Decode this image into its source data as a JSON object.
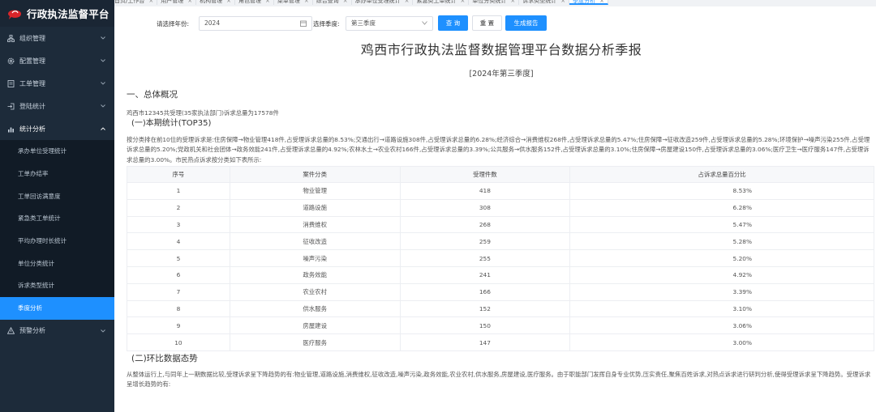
{
  "app": {
    "title": "行政执法监督平台"
  },
  "sidebar": {
    "groups": [
      {
        "label": "组织管理",
        "icon": "org-icon"
      },
      {
        "label": "配置管理",
        "icon": "gear-icon"
      },
      {
        "label": "工单管理",
        "icon": "ticket-icon"
      },
      {
        "label": "登陆统计",
        "icon": "login-icon"
      },
      {
        "label": "统计分析",
        "icon": "chart-icon"
      }
    ],
    "subitems": [
      "承办单位受理统计",
      "工单办结率",
      "工单回访满意度",
      "紧急类工单统计",
      "平均办理时长统计",
      "单位分类统计",
      "诉求类型统计",
      "季度分析"
    ],
    "footer_group": {
      "label": "预警分析",
      "icon": "warning-icon"
    }
  },
  "tabs": [
    "首页/工作台",
    "用户管理",
    "机构管理",
    "角色管理",
    "菜单管理",
    "综合查询",
    "承办单位受理统计",
    "紧急类工单统计",
    "单位分类统计",
    "诉求类型统计",
    "季度分析"
  ],
  "filter": {
    "year_label": "请选择年份:",
    "year_value": "2024",
    "season_label": "选择季度:",
    "season_value": "第三季度",
    "query_button": "查 询",
    "reset_button": "重 置",
    "report_button": "生成报告"
  },
  "report": {
    "title": "鸡西市行政执法监督数据管理平台数据分析季报",
    "period": "[2024年第三季度]",
    "section1_title": "一、总体概况",
    "summary": "鸡西市12345共受理(35家执法部门)诉求总量为17578件",
    "sub1_title": "(一)本期统计(TOP35)",
    "sub1_text": "按分类排在前10位的受理诉求是:住房保障→物业管理418件,占受理诉求总量的8.53%;交通出行→道路设施308件,占受理诉求总量的6.28%;经济综合→消费维权268件,占受理诉求总量的5.47%;住房保障→征收改造259件,占受理诉求总量的5.28%;环境保护→噪声污染255件,占受理诉求总量的5.20%;党政机关和社会团体→政务效能241件,占受理诉求总量的4.92%;农林水土→农业农村166件,占受理诉求总量的3.39%;公共服务→供水服务152件,占受理诉求总量的3.10%;住房保障→房屋建设150件,占受理诉求总量的3.06%;医疗卫生→医疗服务147件,占受理诉求总量的3.00%。市民热点诉求按分类如下表所示:",
    "table": {
      "headers": [
        "序号",
        "案件分类",
        "受理件数",
        "占诉求总量百分比"
      ],
      "rows": [
        [
          "1",
          "物业管理",
          "418",
          "8.53%"
        ],
        [
          "2",
          "道路设施",
          "308",
          "6.28%"
        ],
        [
          "3",
          "消费维权",
          "268",
          "5.47%"
        ],
        [
          "4",
          "征收改造",
          "259",
          "5.28%"
        ],
        [
          "5",
          "噪声污染",
          "255",
          "5.20%"
        ],
        [
          "6",
          "政务效能",
          "241",
          "4.92%"
        ],
        [
          "7",
          "农业农村",
          "166",
          "3.39%"
        ],
        [
          "8",
          "供水服务",
          "152",
          "3.10%"
        ],
        [
          "9",
          "房屋建设",
          "150",
          "3.06%"
        ],
        [
          "10",
          "医疗服务",
          "147",
          "3.00%"
        ]
      ]
    },
    "sub2_title": "(二)环比数据态势",
    "sub2_text": "从整体运行上,与同年上一期数据比较,受理诉求呈下降趋势的有:物业管理,道路设施,消费维权,征收改造,噪声污染,政务效能,农业农村,供水服务,房屋建设,医疗服务。由于职能部门发挥自身专业优势,压实责任,聚焦百姓诉求,对热点诉求进行研判分析,使得受理诉求呈下降趋势。受理诉求呈增长趋势的有:"
  },
  "colors": {
    "sidebar_bg": "#1d2b3a",
    "accent": "#1e90ff"
  }
}
